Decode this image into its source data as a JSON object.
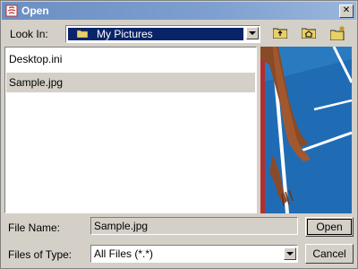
{
  "window": {
    "title": "Open",
    "close_label": "✕"
  },
  "toolbar": {
    "look_in_label": "Look In:",
    "look_in_value": "My Pictures",
    "buttons": [
      {
        "name": "up-one-level-icon"
      },
      {
        "name": "home-folder-icon"
      },
      {
        "name": "new-folder-icon"
      }
    ]
  },
  "files": [
    {
      "name": "Desktop.ini",
      "selected": false
    },
    {
      "name": "Sample.jpg",
      "selected": true
    }
  ],
  "form": {
    "file_name_label": "File Name:",
    "file_name_value": "Sample.jpg",
    "file_type_label": "Files of Type:",
    "file_type_value": "All Files (*.*)"
  },
  "buttons": {
    "open": "Open",
    "cancel": "Cancel"
  },
  "colors": {
    "title_bar": "#7da0d0",
    "selection": "#0a246a",
    "face": "#d4d0c8"
  }
}
